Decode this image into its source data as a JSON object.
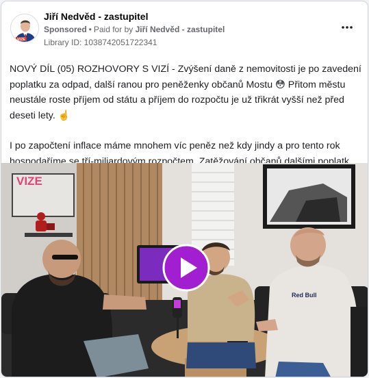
{
  "ad": {
    "author": "Jiří Nedvěd - zastupitel",
    "sponsored_label": "Sponsored",
    "separator": "•",
    "paid_for_prefix": "Paid for by",
    "paid_for_name": "Jiří Nedvěd - zastupitel",
    "library_id": "Library ID: 1038742051722341",
    "more_icon": "more-horizontal-icon"
  },
  "body": {
    "paragraph_1": "NOVÝ DÍL (05) ROZHOVORY S VIZÍ - Zvýšení daně z nemovitosti je po zavedení poplatku za odpad, další ranou pro peněženky občanů Mostu 😳  Přitom městu neustále roste příjem od státu a příjem do rozpočtu je už třikrát vyšší než před deseti lety. ☝️",
    "paragraph_2_line_1": "I po započtení inflace máme mnohem víc peněz než kdy jindy a pro tento rok",
    "paragraph_2_line_2": "hospodaříme se tří-miliardovým rozpočtem. Zatěžování občanů dalšími poplatky ..."
  },
  "video": {
    "wall_logo": "VIZE",
    "hoodie_text": "Red Bull",
    "play_icon": "play-icon",
    "accent_color": "#a11fd1"
  },
  "avatar": {
    "badge_text": "VIZE"
  }
}
